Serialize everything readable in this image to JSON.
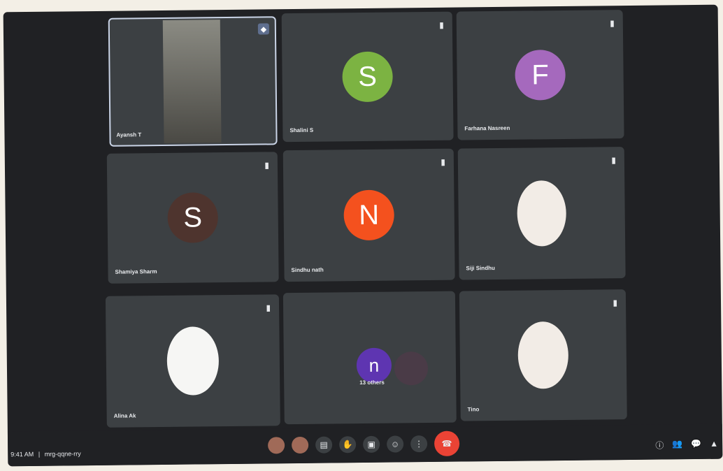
{
  "colors": {
    "background": "#202124",
    "tile": "#3c4043",
    "end_call": "#ea4335",
    "avatar_s1": "#7cb342",
    "avatar_f": "#a569bd",
    "avatar_s2": "#4e342e",
    "avatar_n": "#f4511e",
    "avatar_n2": "#5e35b1"
  },
  "tiles": [
    {
      "name": "Ayansh T",
      "type": "video",
      "active": true
    },
    {
      "name": "Shalini S",
      "type": "avatar",
      "initial": "S"
    },
    {
      "name": "Farhana Nasreen",
      "type": "avatar",
      "initial": "F"
    },
    {
      "name": "Shamiya Sharm",
      "type": "avatar",
      "initial": "S"
    },
    {
      "name": "Sindhu nath",
      "type": "avatar",
      "initial": "N"
    },
    {
      "name": "Siji Sindhu",
      "type": "photo"
    },
    {
      "name": "Alina Ak",
      "type": "photo"
    },
    {
      "name": "13 others",
      "type": "group",
      "initial": "n"
    },
    {
      "name": "Tino",
      "type": "photo"
    }
  ],
  "bottom": {
    "time": "9:41 AM",
    "meeting": "mrg-qqne-rry"
  },
  "icons": {
    "mute": "mic-off-icon",
    "pin": "pin-icon",
    "captions": "captions-icon",
    "hand": "hand-icon",
    "present": "present-icon",
    "more": "more-icon",
    "end": "end-call-icon",
    "info": "info-icon",
    "people": "people-icon",
    "chat": "chat-icon",
    "activities": "activities-icon"
  }
}
